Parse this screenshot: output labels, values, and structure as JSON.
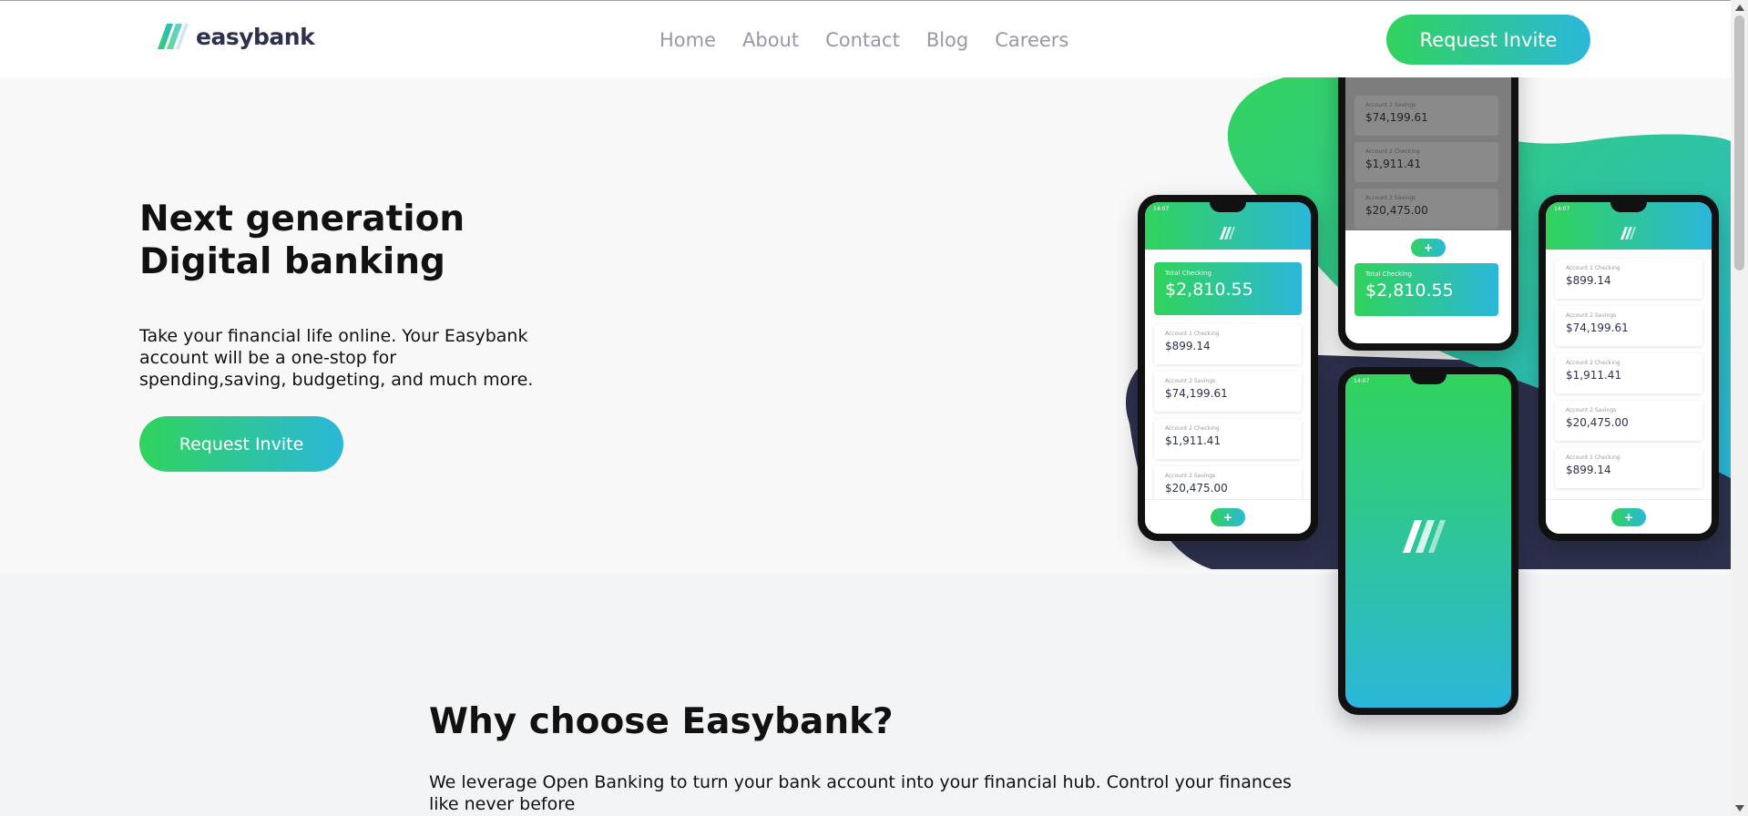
{
  "header": {
    "logo_text": "easybank",
    "nav": [
      "Home",
      "About",
      "Contact",
      "Blog",
      "Careers"
    ],
    "cta_label": "Request Invite"
  },
  "hero": {
    "title_line1": "Next generation",
    "title_line2": "Digital banking",
    "description": "Take your financial life online. Your Easybank account will be a one-stop for spending,saving, budgeting, and much more.",
    "cta_label": "Request Invite"
  },
  "phones": {
    "status_time": "14:07",
    "total_label": "Total Checking",
    "total_amount": "$2,810.55",
    "fab_symbol": "+",
    "left_accounts": [
      {
        "label": "Account 1 Checking",
        "amount": "$899.14"
      },
      {
        "label": "Account 2 Savings",
        "amount": "$74,199.61"
      },
      {
        "label": "Account 2 Checking",
        "amount": "$1,911.41"
      },
      {
        "label": "Account 2 Savings",
        "amount": "$20,475.00"
      }
    ],
    "top_accounts": [
      {
        "label": "Account 2 Savings",
        "amount": "$74,199.61"
      },
      {
        "label": "Account 2 Checking",
        "amount": "$1,911.41"
      },
      {
        "label": "Account 2 Savings",
        "amount": "$20,475.00"
      }
    ],
    "right_accounts": [
      {
        "label": "Account 1 Checking",
        "amount": "$899.14"
      },
      {
        "label": "Account 2 Savings",
        "amount": "$74,199.61"
      },
      {
        "label": "Account 2 Checking",
        "amount": "$1,911.41"
      },
      {
        "label": "Account 2 Savings",
        "amount": "$20,475.00"
      },
      {
        "label": "Account 1 Checking",
        "amount": "$899.14"
      }
    ]
  },
  "why": {
    "title": "Why choose Easybank?",
    "description": "We leverage Open Banking to turn your bank account into your financial hub. Control your finances like never before"
  },
  "colors": {
    "brand_green": "#31d35c",
    "brand_cyan": "#2bb7da",
    "dark_blue": "#2d314d",
    "nav_gray": "#9698a6"
  }
}
